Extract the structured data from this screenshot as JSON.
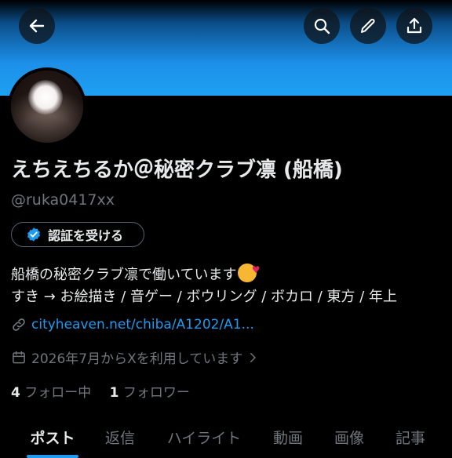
{
  "header": {
    "back_icon": "arrow-left-icon",
    "search_icon": "search-icon",
    "edit_icon": "pencil-icon",
    "share_icon": "share-icon"
  },
  "profile": {
    "display_name": "えちえちるか＠秘密クラブ凛 (船橋)",
    "handle": "@ruka0417xx",
    "verify_button_label": "認証を受ける",
    "bio_line1": "船橋の秘密クラブ凛で働いています",
    "bio_line2": "すき → お絵描き / 音ゲー / ボウリング / ボカロ / 東方 / 年上",
    "link": "cityheaven.net/chiba/A1202/A1...",
    "joined": "2026年7月からXを利用しています",
    "following_count": "4",
    "following_label": "フォロー中",
    "followers_count": "1",
    "followers_label": "フォロワー"
  },
  "tabs": [
    {
      "label": "ポスト",
      "active": true
    },
    {
      "label": "返信"
    },
    {
      "label": "ハイライト"
    },
    {
      "label": "動画"
    },
    {
      "label": "画像"
    },
    {
      "label": "記事"
    }
  ],
  "colors": {
    "accent": "#1d9bf0",
    "banner": "#1da1f2",
    "background": "#000000",
    "text": "#e7e9ea",
    "muted": "#71767b"
  }
}
